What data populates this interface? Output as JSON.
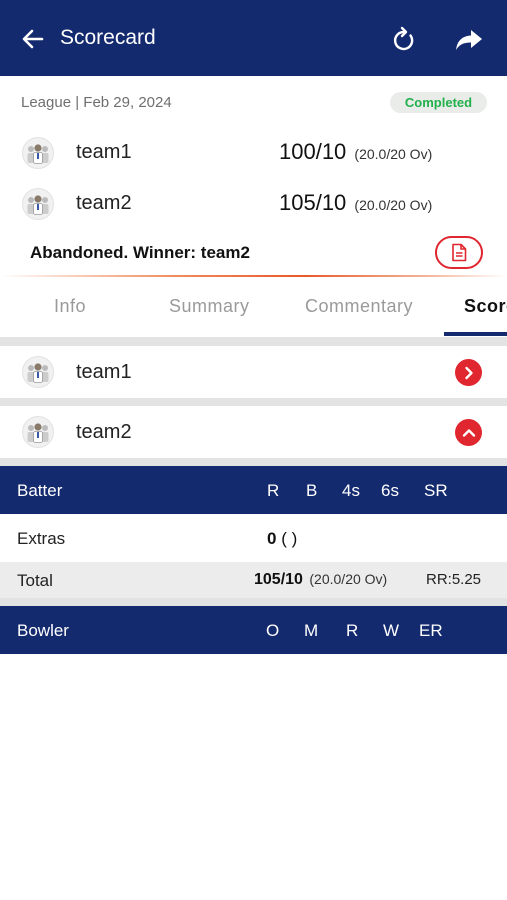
{
  "header": {
    "title": "Scorecard",
    "back_icon": "arrow-left-icon",
    "refresh_icon": "refresh-icon",
    "share_icon": "share-icon",
    "bg_color": "#142a6e"
  },
  "match": {
    "meta": "League | Feb 29, 2024",
    "status": "Completed",
    "status_color": "#22b04b",
    "teams": [
      {
        "name": "team1",
        "score": "100/10",
        "overs": "(20.0/20 Ov)"
      },
      {
        "name": "team2",
        "score": "105/10",
        "overs": "(20.0/20 Ov)"
      }
    ],
    "result": "Abandoned. Winner: team2",
    "accent_color": "#e0262e"
  },
  "tabs": [
    {
      "label": "Info",
      "active": false
    },
    {
      "label": "Summary",
      "active": false
    },
    {
      "label": "Commentary",
      "active": false
    },
    {
      "label": "Scorecard",
      "active": true
    }
  ],
  "innings": [
    {
      "name": "team1",
      "expanded": false
    },
    {
      "name": "team2",
      "expanded": true
    }
  ],
  "batting_table": {
    "header": "Batter",
    "columns": [
      "R",
      "B",
      "4s",
      "6s",
      "SR"
    ],
    "extras_label": "Extras",
    "extras_value": "0",
    "extras_detail": "( )",
    "total_label": "Total",
    "total_value": "105/10",
    "total_overs": "(20.0/20 Ov)",
    "run_rate": "RR:5.25"
  },
  "bowling_table": {
    "header": "Bowler",
    "columns": [
      "O",
      "M",
      "R",
      "W",
      "ER"
    ]
  }
}
